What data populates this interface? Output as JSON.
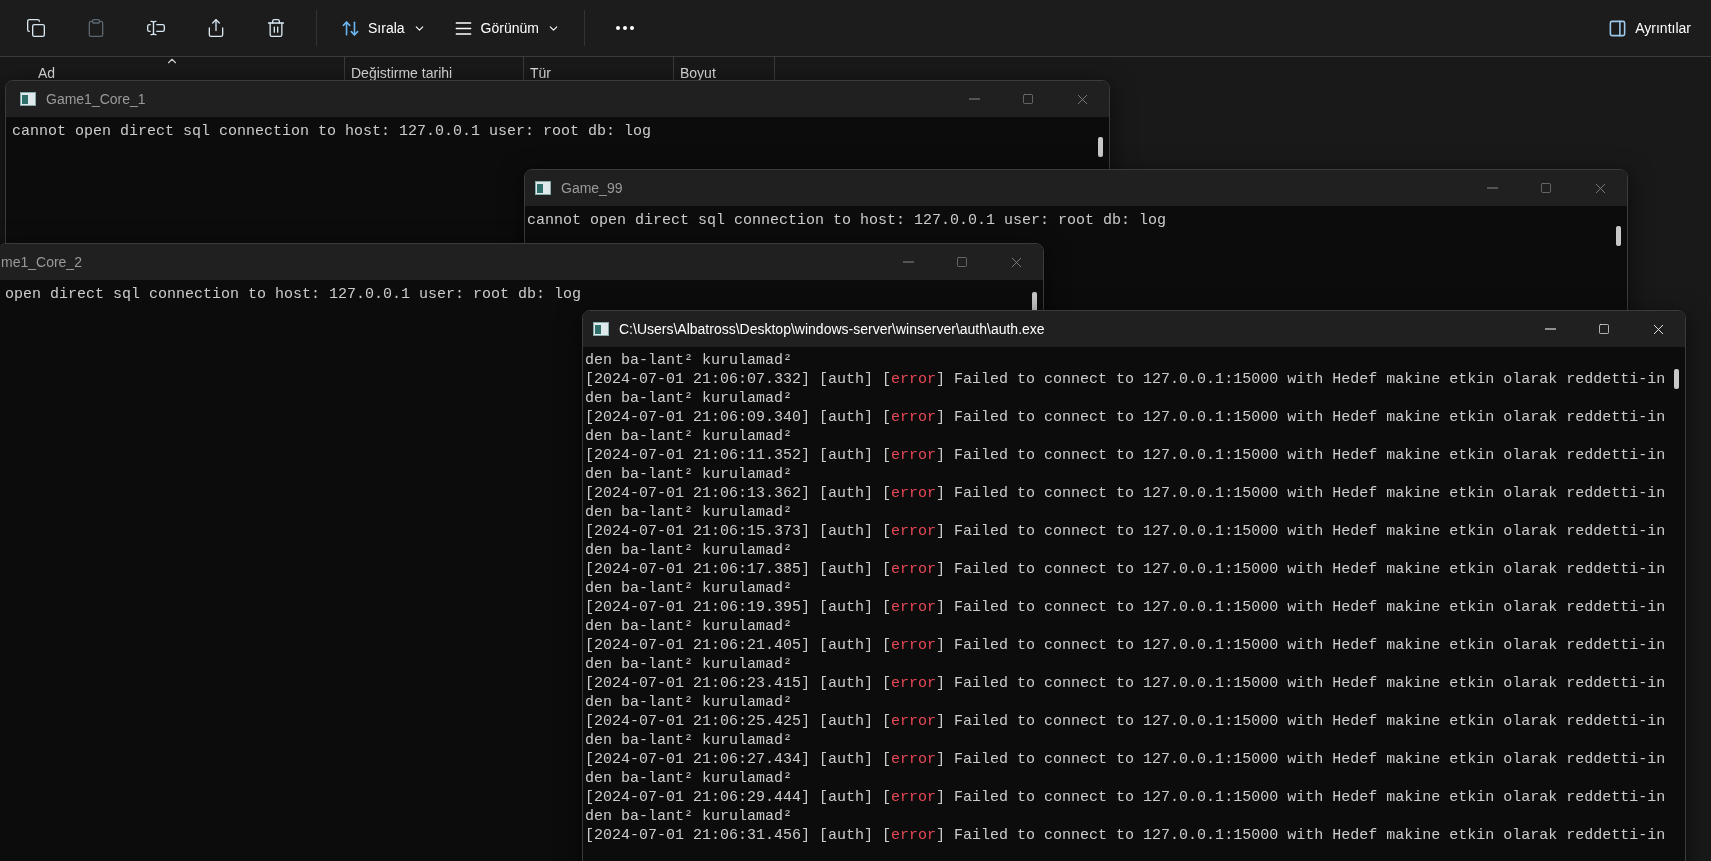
{
  "toolbar": {
    "icon_buttons": [
      {
        "kind": "copy",
        "disabled": false
      },
      {
        "kind": "paste",
        "disabled": true
      },
      {
        "kind": "rename",
        "disabled": false
      },
      {
        "kind": "share",
        "disabled": false
      },
      {
        "kind": "delete",
        "disabled": false
      }
    ],
    "sort_button": {
      "label": "Sırala"
    },
    "view_button": {
      "label": "Görünüm"
    },
    "details_button": {
      "label": "Ayrıntılar"
    }
  },
  "columns": [
    {
      "label": "Ad",
      "sorted": true
    },
    {
      "label": "Değistirme tarihi",
      "sorted": false
    },
    {
      "label": "Tür",
      "sorted": false
    },
    {
      "label": "Boyut",
      "sorted": false
    }
  ],
  "windows": [
    {
      "title": "Game1_Core_1",
      "active": false,
      "lines": [
        {
          "kind": "plain",
          "text": "cannot open direct sql connection to host: 127.0.0.1 user: root db: log"
        }
      ]
    },
    {
      "title": "Game_99",
      "active": false,
      "lines": [
        {
          "kind": "plain",
          "text": "cannot open direct sql connection to host: 127.0.0.1 user: root db: log"
        }
      ]
    },
    {
      "title": "me1_Core_2",
      "active": false,
      "lines": [
        {
          "kind": "plain",
          "text": "open direct sql connection to host: 127.0.0.1 user: root db: log"
        }
      ]
    },
    {
      "title": "C:\\Users\\Albatross\\Desktop\\windows-server\\winserver\\auth\\auth.exe",
      "active": true,
      "lines": [
        {
          "kind": "plain",
          "text": "den ba-lant² kurulamad²"
        },
        {
          "kind": "log",
          "head": "[2024-07-01 21:06:07.332] [auth] [",
          "tag": "error",
          "color": "#e74856",
          "tail": "] Failed to connect to 127.0.0.1:15000 with Hedef makine etkin olarak reddetti-in"
        },
        {
          "kind": "plain",
          "text": "den ba-lant² kurulamad²"
        },
        {
          "kind": "log",
          "head": "[2024-07-01 21:06:09.340] [auth] [",
          "tag": "error",
          "color": "#e74856",
          "tail": "] Failed to connect to 127.0.0.1:15000 with Hedef makine etkin olarak reddetti-in"
        },
        {
          "kind": "plain",
          "text": "den ba-lant² kurulamad²"
        },
        {
          "kind": "log",
          "head": "[2024-07-01 21:06:11.352] [auth] [",
          "tag": "error",
          "color": "#e74856",
          "tail": "] Failed to connect to 127.0.0.1:15000 with Hedef makine etkin olarak reddetti-in"
        },
        {
          "kind": "plain",
          "text": "den ba-lant² kurulamad²"
        },
        {
          "kind": "log",
          "head": "[2024-07-01 21:06:13.362] [auth] [",
          "tag": "error",
          "color": "#e74856",
          "tail": "] Failed to connect to 127.0.0.1:15000 with Hedef makine etkin olarak reddetti-in"
        },
        {
          "kind": "plain",
          "text": "den ba-lant² kurulamad²"
        },
        {
          "kind": "log",
          "head": "[2024-07-01 21:06:15.373] [auth] [",
          "tag": "error",
          "color": "#e74856",
          "tail": "] Failed to connect to 127.0.0.1:15000 with Hedef makine etkin olarak reddetti-in"
        },
        {
          "kind": "plain",
          "text": "den ba-lant² kurulamad²"
        },
        {
          "kind": "log",
          "head": "[2024-07-01 21:06:17.385] [auth] [",
          "tag": "error",
          "color": "#e74856",
          "tail": "] Failed to connect to 127.0.0.1:15000 with Hedef makine etkin olarak reddetti-in"
        },
        {
          "kind": "plain",
          "text": "den ba-lant² kurulamad²"
        },
        {
          "kind": "log",
          "head": "[2024-07-01 21:06:19.395] [auth] [",
          "tag": "error",
          "color": "#e74856",
          "tail": "] Failed to connect to 127.0.0.1:15000 with Hedef makine etkin olarak reddetti-in"
        },
        {
          "kind": "plain",
          "text": "den ba-lant² kurulamad²"
        },
        {
          "kind": "log",
          "head": "[2024-07-01 21:06:21.405] [auth] [",
          "tag": "error",
          "color": "#e74856",
          "tail": "] Failed to connect to 127.0.0.1:15000 with Hedef makine etkin olarak reddetti-in"
        },
        {
          "kind": "plain",
          "text": "den ba-lant² kurulamad²"
        },
        {
          "kind": "log",
          "head": "[2024-07-01 21:06:23.415] [auth] [",
          "tag": "error",
          "color": "#e74856",
          "tail": "] Failed to connect to 127.0.0.1:15000 with Hedef makine etkin olarak reddetti-in"
        },
        {
          "kind": "plain",
          "text": "den ba-lant² kurulamad²"
        },
        {
          "kind": "log",
          "head": "[2024-07-01 21:06:25.425] [auth] [",
          "tag": "error",
          "color": "#e74856",
          "tail": "] Failed to connect to 127.0.0.1:15000 with Hedef makine etkin olarak reddetti-in"
        },
        {
          "kind": "plain",
          "text": "den ba-lant² kurulamad²"
        },
        {
          "kind": "log",
          "head": "[2024-07-01 21:06:27.434] [auth] [",
          "tag": "error",
          "color": "#e74856",
          "tail": "] Failed to connect to 127.0.0.1:15000 with Hedef makine etkin olarak reddetti-in"
        },
        {
          "kind": "plain",
          "text": "den ba-lant² kurulamad²"
        },
        {
          "kind": "log",
          "head": "[2024-07-01 21:06:29.444] [auth] [",
          "tag": "error",
          "color": "#e74856",
          "tail": "] Failed to connect to 127.0.0.1:15000 with Hedef makine etkin olarak reddetti-in"
        },
        {
          "kind": "plain",
          "text": "den ba-lant² kurulamad²"
        },
        {
          "kind": "log",
          "head": "[2024-07-01 21:06:31.456] [auth] [",
          "tag": "error",
          "color": "#e74856",
          "tail": "] Failed to connect to 127.0.0.1:15000 with Hedef makine etkin olarak reddetti-in"
        }
      ]
    }
  ]
}
